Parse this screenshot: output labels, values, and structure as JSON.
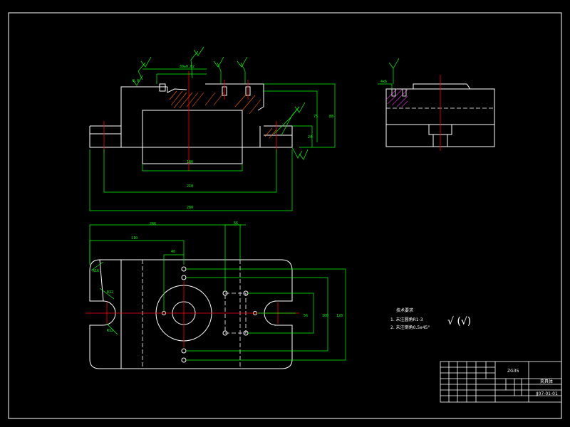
{
  "colors": {
    "background": "#000000",
    "outline": "#ffffff",
    "dimension": "#00ff00",
    "centerline": "#ff0000",
    "hidden": "#ffffff",
    "hatch": "#ff6600",
    "section_hatch": "#cc33cc",
    "roughness": "#00ffff"
  },
  "tech_requirements": {
    "title": "技术要求",
    "items": [
      "1. 未注圆角R1-3",
      "2. 未注倒角0.5x45°"
    ]
  },
  "roughness_note": "√ (√)",
  "title_block": {
    "center_label": "ZG35",
    "part_name": "夹具体",
    "drawing_no": "JJ07-01-01"
  }
}
